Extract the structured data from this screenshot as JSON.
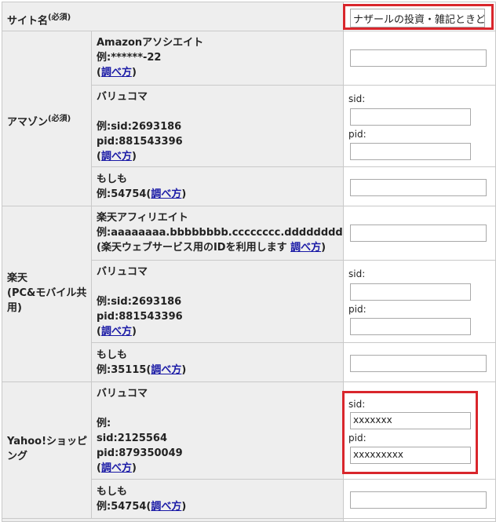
{
  "site_name": {
    "label": "サイト名",
    "req": "(必須)",
    "value": "ナザールの投資・雑記ときど"
  },
  "amazon": {
    "label": "アマゾン",
    "req": "(必須)",
    "associate": {
      "title": "Amazonアソシエイト",
      "example": "例:******-22",
      "link": "調べ方"
    },
    "valuecommerce": {
      "title": "バリュコマ",
      "ex1": "例:sid:2693186",
      "ex2": "pid:881543396",
      "link": "調べ方",
      "sid_label": "sid:",
      "pid_label": "pid:"
    },
    "moshimo": {
      "title": "もしも",
      "example": "例:54754(",
      "link": "調べ方"
    }
  },
  "rakuten": {
    "label1": "楽天",
    "label2": "(PC&モバイル共",
    "label3": "用)",
    "affiliate": {
      "title": "楽天アフィリエイト",
      "example": "例:aaaaaaaa.bbbbbbbb.cccccccc.dddddddd",
      "note": "(楽天ウェブサービス用のIDを利用します ",
      "link": "調べ方"
    },
    "valuecommerce": {
      "title": "バリュコマ",
      "ex1": "例:sid:2693186",
      "ex2": "pid:881543396",
      "link": "調べ方",
      "sid_label": "sid:",
      "pid_label": "pid:"
    },
    "moshimo": {
      "title": "もしも",
      "example": "例:35115(",
      "link": "調べ方"
    }
  },
  "yahoo": {
    "label1": "Yahoo!ショッピ",
    "label2": "ング",
    "valuecommerce": {
      "title": "バリュコマ",
      "ex0": "例:",
      "ex1": "sid:2125564",
      "ex2": "pid:879350049",
      "link": "調べ方",
      "sid_label": "sid:",
      "pid_label": "pid:",
      "sid_value": "xxxxxxx",
      "pid_value": "xxxxxxxxx"
    },
    "moshimo": {
      "title": "もしも",
      "example": "例:54754(",
      "link": "調べ方"
    }
  },
  "common": {
    "paren_open": "(",
    "paren_close": ")"
  }
}
